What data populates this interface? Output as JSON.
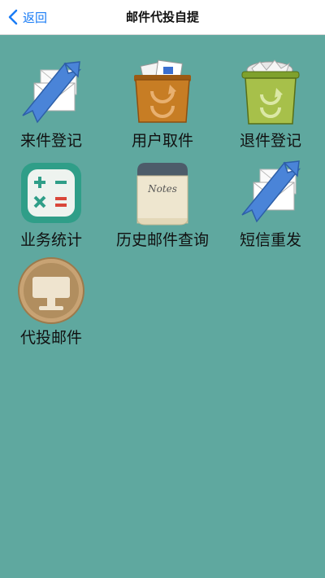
{
  "header": {
    "title": "邮件代投自提",
    "back_label": "返回"
  },
  "tiles": [
    {
      "label": "来件登记",
      "icon": "send-mail-icon"
    },
    {
      "label": "用户取件",
      "icon": "mail-box-icon"
    },
    {
      "label": "退件登记",
      "icon": "recycle-bin-icon"
    },
    {
      "label": "业务统计",
      "icon": "calculator-icon"
    },
    {
      "label": "历史邮件查询",
      "icon": "notes-icon"
    },
    {
      "label": "短信重发",
      "icon": "send-mail-icon"
    },
    {
      "label": "代投邮件",
      "icon": "presentation-icon"
    }
  ],
  "colors": {
    "background": "#5fa89f",
    "accent": "#1a7cf5"
  }
}
